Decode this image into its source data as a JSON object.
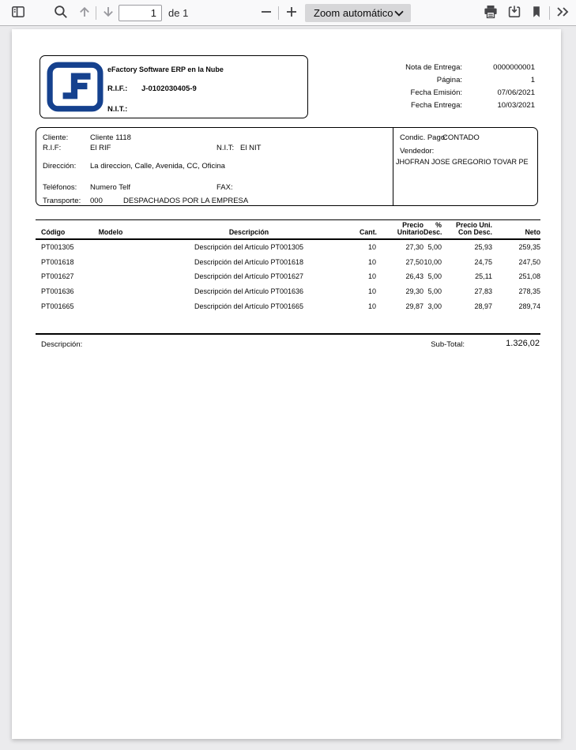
{
  "toolbar": {
    "page_input": "1",
    "page_count": "de 1",
    "zoom_value": "Zoom automático"
  },
  "colors": {
    "logo_blue": "#15418e",
    "toolbar_bg": "#f9f9fa",
    "viewer_bg": "#ebebed"
  },
  "doc": {
    "company": {
      "name": "eFactory Software ERP en la Nube",
      "rif_label": "R.I.F.:",
      "rif": "J-0102030405-9",
      "nit_label": "N.I.T.:",
      "nit": ""
    },
    "meta": {
      "rows": [
        {
          "label": "Nota de Entrega:",
          "value": "0000000001"
        },
        {
          "label": "Página:",
          "value": "1"
        },
        {
          "label": "Fecha Emisión:",
          "value": "07/06/2021"
        },
        {
          "label": "Fecha Entrega:",
          "value": "10/03/2021"
        }
      ]
    },
    "client": {
      "cliente_label": "Cliente:",
      "cliente": "Cliente 1118",
      "rif_label": "R.I.F:",
      "rif": "El RIF",
      "nit_label": "N.I.T:",
      "nit": "El NIT",
      "direccion_label": "Dirección:",
      "direccion": "La direccion, Calle, Avenida, CC, Oficina",
      "telefonos_label": "Teléfonos:",
      "telefonos": "Numero Telf",
      "fax_label": "FAX:",
      "fax": "",
      "transporte_label": "Transporte:",
      "transporte_code": "000",
      "transporte_desc": "DESPACHADOS POR LA EMPRESA"
    },
    "payment": {
      "condic_label": "Condic. Pago:",
      "condic": "CONTADO",
      "vendedor_label": "Vendedor:",
      "vendedor": "JHOFRAN JOSE GREGORIO TOVAR PE"
    },
    "table": {
      "headers": {
        "codigo": "Código",
        "modelo": "Modelo",
        "descripcion": "Descripción",
        "cant": "Cant.",
        "precio_unitario": "Precio\nUnitario",
        "pct_desc": "%\nDesc.",
        "precio_con_desc": "Precio Uni.\nCon Desc.",
        "neto": "Neto"
      },
      "rows": [
        {
          "codigo": "PT001305",
          "modelo": "",
          "descripcion": "Descripción del Artículo PT001305",
          "cant": "10",
          "precio_unitario": "27,30",
          "pct_desc": "5,00",
          "precio_con_desc": "25,93",
          "neto": "259,35"
        },
        {
          "codigo": "PT001618",
          "modelo": "",
          "descripcion": "Descripción del Artículo PT001618",
          "cant": "10",
          "precio_unitario": "27,50",
          "pct_desc": "10,00",
          "precio_con_desc": "24,75",
          "neto": "247,50"
        },
        {
          "codigo": "PT001627",
          "modelo": "",
          "descripcion": "Descripción del Artículo PT001627",
          "cant": "10",
          "precio_unitario": "26,43",
          "pct_desc": "5,00",
          "precio_con_desc": "25,11",
          "neto": "251,08"
        },
        {
          "codigo": "PT001636",
          "modelo": "",
          "descripcion": "Descripción del Artículo PT001636",
          "cant": "10",
          "precio_unitario": "29,30",
          "pct_desc": "5,00",
          "precio_con_desc": "27,83",
          "neto": "278,35"
        },
        {
          "codigo": "PT001665",
          "modelo": "",
          "descripcion": "Descripción del Artículo PT001665",
          "cant": "10",
          "precio_unitario": "29,87",
          "pct_desc": "3,00",
          "precio_con_desc": "28,97",
          "neto": "289,74"
        }
      ]
    },
    "footer": {
      "descripcion_label": "Descripción:",
      "subtotal_label": "Sub-Total:",
      "subtotal": "1.326,02"
    }
  }
}
